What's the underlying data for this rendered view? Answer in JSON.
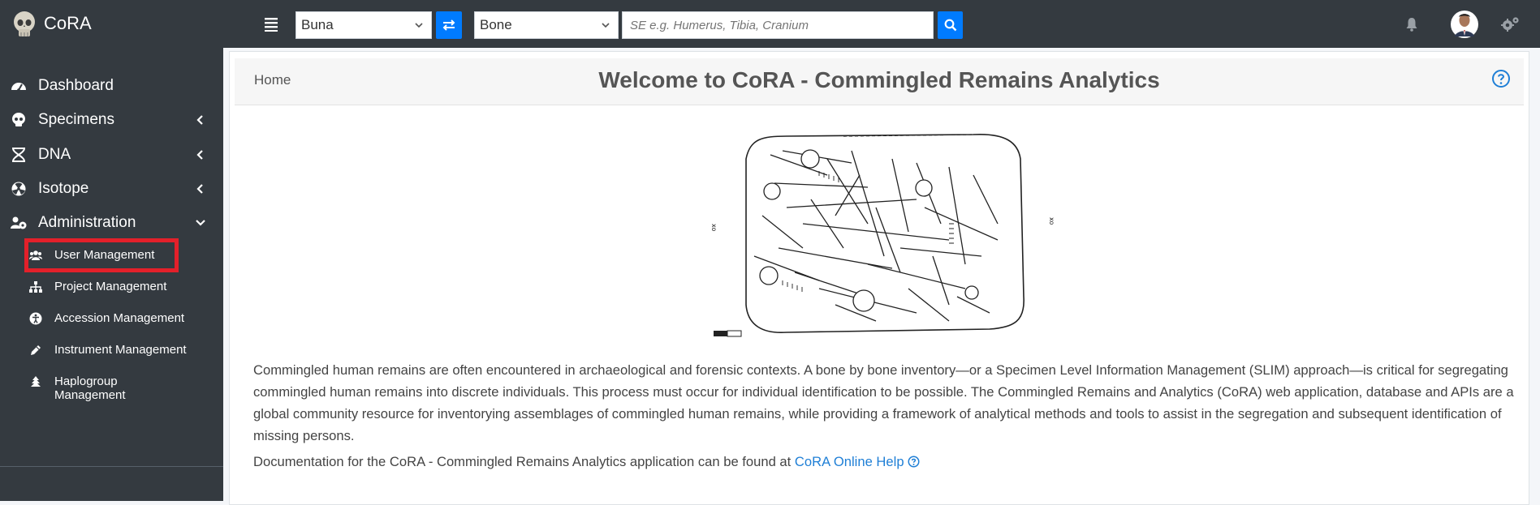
{
  "app": {
    "name": "CoRA"
  },
  "toolbar": {
    "project_select": "Buna",
    "type_select": "Bone",
    "search_placeholder": "SE e.g. Humerus, Tibia, Cranium"
  },
  "sidebar": {
    "items": [
      {
        "label": "Dashboard",
        "icon": "dashboard-icon",
        "arrow": ""
      },
      {
        "label": "Specimens",
        "icon": "skull-icon",
        "arrow": "chevron-left"
      },
      {
        "label": "DNA",
        "icon": "dna-icon",
        "arrow": "chevron-left"
      },
      {
        "label": "Isotope",
        "icon": "radiation-icon",
        "arrow": "chevron-left"
      },
      {
        "label": "Administration",
        "icon": "users-cog-icon",
        "arrow": "chevron-down"
      }
    ],
    "admin_subitems": [
      {
        "label": "User Management",
        "icon": "users-icon"
      },
      {
        "label": "Project Management",
        "icon": "sitemap-icon"
      },
      {
        "label": "Accession Management",
        "icon": "accessibility-icon"
      },
      {
        "label": "Instrument Management",
        "icon": "pen-icon"
      },
      {
        "label": "Haplogroup Management",
        "icon": "tree-icon"
      }
    ],
    "highlight_color": "#e3202a"
  },
  "content": {
    "breadcrumb": "Home",
    "title": "Welcome to CoRA - Commingled Remains Analytics",
    "description": "Commingled human remains are often encountered in archaeological and forensic contexts. A bone by bone inventory—or a Specimen Level Information Management (SLIM) approach—is critical for segregating commingled human remains into discrete individuals. This process must occur for individual identification to be possible. The Commingled Remains and Analytics (CoRA) web application, database and APIs are a global community resource for inventorying assemblages of commingled human remains, while providing a framework of analytical methods and tools to assist in the segregation and subsequent identification of missing persons.",
    "doc_text": "Documentation for the CoRA - Commingled Remains Analytics application can be found at",
    "doc_link": "CoRA Online Help"
  },
  "colors": {
    "topbar": "#343a40",
    "accent": "#007bff",
    "link": "#1f7fd6"
  }
}
